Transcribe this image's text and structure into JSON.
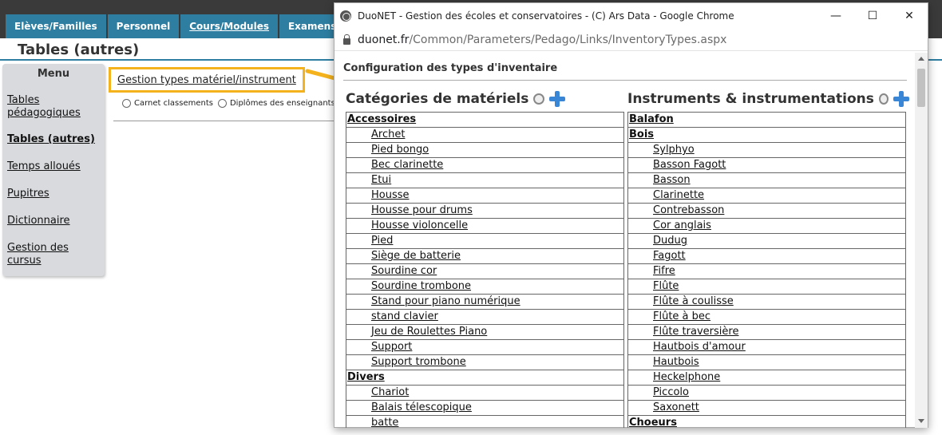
{
  "nav": {
    "tabs": [
      "Elèves/Familles",
      "Personnel",
      "Cours/Modules",
      "Examens/Con"
    ]
  },
  "page": {
    "title": "Tables (autres)"
  },
  "sidebar": {
    "title": "Menu",
    "items": [
      {
        "label": "Tables pédagogiques"
      },
      {
        "label": "Tables (autres)"
      },
      {
        "label": "Temps alloués"
      },
      {
        "label": "Pupitres"
      },
      {
        "label": "Dictionnaire"
      },
      {
        "label": "Gestion des cursus"
      }
    ]
  },
  "main": {
    "link": "Gestion types matériel/instrument",
    "radios": [
      "Carnet classements",
      "Diplômes des enseignants",
      ""
    ]
  },
  "popup": {
    "window_title": "DuoNET - Gestion des écoles et conservatoires - (C) Ars Data - Google Chrome",
    "url_domain": "duonet.fr",
    "url_path": "/Common/Parameters/Pedago/Links/InventoryTypes.aspx",
    "section_title": "Configuration des types d'inventaire",
    "left": {
      "title": "Catégories de matériels",
      "rows": [
        {
          "type": "group",
          "label": "Accessoires"
        },
        {
          "type": "item",
          "label": "Archet"
        },
        {
          "type": "item",
          "label": "Pied bongo"
        },
        {
          "type": "item",
          "label": "Bec clarinette"
        },
        {
          "type": "item",
          "label": "Etui"
        },
        {
          "type": "item",
          "label": "Housse"
        },
        {
          "type": "item",
          "label": "Housse pour drums"
        },
        {
          "type": "item",
          "label": "Housse violoncelle"
        },
        {
          "type": "item",
          "label": "Pied"
        },
        {
          "type": "item",
          "label": "Siège de batterie"
        },
        {
          "type": "item",
          "label": "Sourdine cor"
        },
        {
          "type": "item",
          "label": "Sourdine trombone"
        },
        {
          "type": "item",
          "label": "Stand pour piano numérique"
        },
        {
          "type": "item",
          "label": "stand clavier"
        },
        {
          "type": "item",
          "label": "Jeu de Roulettes Piano"
        },
        {
          "type": "item",
          "label": "Support"
        },
        {
          "type": "item",
          "label": "Support trombone"
        },
        {
          "type": "group",
          "label": "Divers"
        },
        {
          "type": "item",
          "label": "Chariot"
        },
        {
          "type": "item",
          "label": "Balais télescopique"
        },
        {
          "type": "item",
          "label": "batte"
        }
      ]
    },
    "right": {
      "title": "Instruments & instrumentations",
      "rows": [
        {
          "type": "group",
          "label": "Balafon"
        },
        {
          "type": "group",
          "label": "Bois"
        },
        {
          "type": "item",
          "label": "Sylphyo"
        },
        {
          "type": "item",
          "label": "Basson Fagott"
        },
        {
          "type": "item",
          "label": "Basson"
        },
        {
          "type": "item",
          "label": "Clarinette"
        },
        {
          "type": "item",
          "label": "Contrebasson"
        },
        {
          "type": "item",
          "label": "Cor anglais"
        },
        {
          "type": "item",
          "label": "Dudug"
        },
        {
          "type": "item",
          "label": "Fagott"
        },
        {
          "type": "item",
          "label": "Fifre"
        },
        {
          "type": "item",
          "label": "Flûte"
        },
        {
          "type": "item",
          "label": "Flûte à coulisse"
        },
        {
          "type": "item",
          "label": "Flûte à bec"
        },
        {
          "type": "item",
          "label": "Flûte traversière"
        },
        {
          "type": "item",
          "label": "Hautbois d'amour"
        },
        {
          "type": "item",
          "label": "Hautbois"
        },
        {
          "type": "item",
          "label": "Heckelphone"
        },
        {
          "type": "item",
          "label": "Piccolo"
        },
        {
          "type": "item",
          "label": "Saxonett"
        },
        {
          "type": "group",
          "label": "Choeurs"
        }
      ]
    }
  },
  "colors": {
    "nav_tab": "#2e7ea1",
    "highlight": "#f4b21c",
    "plus": "#3a86d6"
  }
}
